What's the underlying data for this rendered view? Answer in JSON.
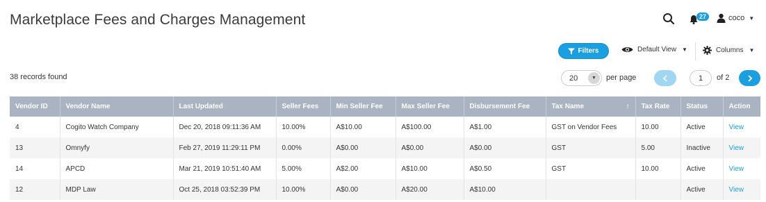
{
  "page": {
    "title": "Marketplace Fees and Charges Management"
  },
  "header": {
    "notification_count": "27",
    "user_name": "coco",
    "icons": {
      "search": "search-icon",
      "bell": "bell-icon",
      "user": "user-icon"
    }
  },
  "toolbar": {
    "filters_label": "Filters",
    "view_label": "Default View",
    "columns_label": "Columns"
  },
  "records_found": "38 records found",
  "pagination": {
    "per_page_value": "20",
    "per_page_label": "per page",
    "current_page": "1",
    "of_label": "of 2"
  },
  "table": {
    "columns": [
      "Vendor ID",
      "Vendor Name",
      "Last Updated",
      "Seller Fees",
      "Min Seller Fee",
      "Max Seller Fee",
      "Disbursement Fee",
      "Tax Name",
      "Tax Rate",
      "Status",
      "Action"
    ],
    "sort_indicator": "↑",
    "rows": [
      [
        "4",
        "Cogito Watch Company",
        "Dec 20, 2018 09:11:36 AM",
        "10.00%",
        "A$10.00",
        "A$100.00",
        "A$1.00",
        "GST on Vendor Fees",
        "10.00",
        "Active",
        "View"
      ],
      [
        "13",
        "Omnyfy",
        "Feb 27, 2019 11:29:11 PM",
        "0.00%",
        "A$0.00",
        "A$0.00",
        "A$0.00",
        "GST",
        "5.00",
        "Inactive",
        "View"
      ],
      [
        "14",
        "APCD",
        "Mar 21, 2019 10:51:40 AM",
        "5.00%",
        "A$2.00",
        "A$10.00",
        "A$0.50",
        "GST",
        "10.00",
        "Active",
        "View"
      ],
      [
        "12",
        "MDP Law",
        "Oct 25, 2018 03:52:39 PM",
        "10.00%",
        "A$0.00",
        "A$20.00",
        "A$10.00",
        "",
        "",
        "Active",
        "View"
      ]
    ]
  },
  "colors": {
    "accent": "#1a9fe0",
    "header_bg": "#a9b3c1"
  }
}
